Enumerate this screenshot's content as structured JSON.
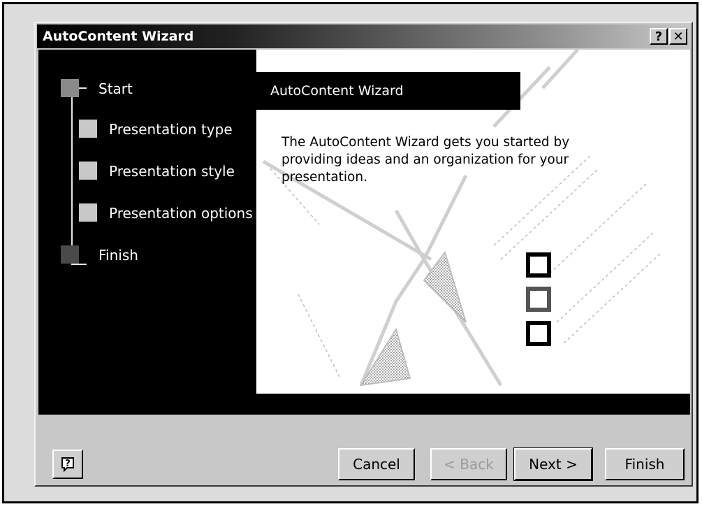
{
  "window": {
    "title": "AutoContent Wizard",
    "help_button_label": "?",
    "close_button_label": "✕"
  },
  "steps": [
    {
      "label": "Start",
      "state": "current"
    },
    {
      "label": "Presentation type",
      "state": "pending"
    },
    {
      "label": "Presentation style",
      "state": "pending"
    },
    {
      "label": "Presentation options",
      "state": "pending"
    },
    {
      "label": "Finish",
      "state": "final"
    }
  ],
  "content": {
    "header": "AutoContent Wizard",
    "description": "The AutoContent Wizard gets you started by providing ideas and an organization for your presentation."
  },
  "footer": {
    "help_icon_label": "?",
    "cancel_label": "Cancel",
    "back_label": "< Back",
    "next_label": "Next >",
    "finish_label": "Finish"
  },
  "colors": {
    "current_step": "#8a8a8a",
    "pending_step": "#c8c8c8",
    "final_step": "#4a4a4a",
    "panel": "#000000"
  }
}
